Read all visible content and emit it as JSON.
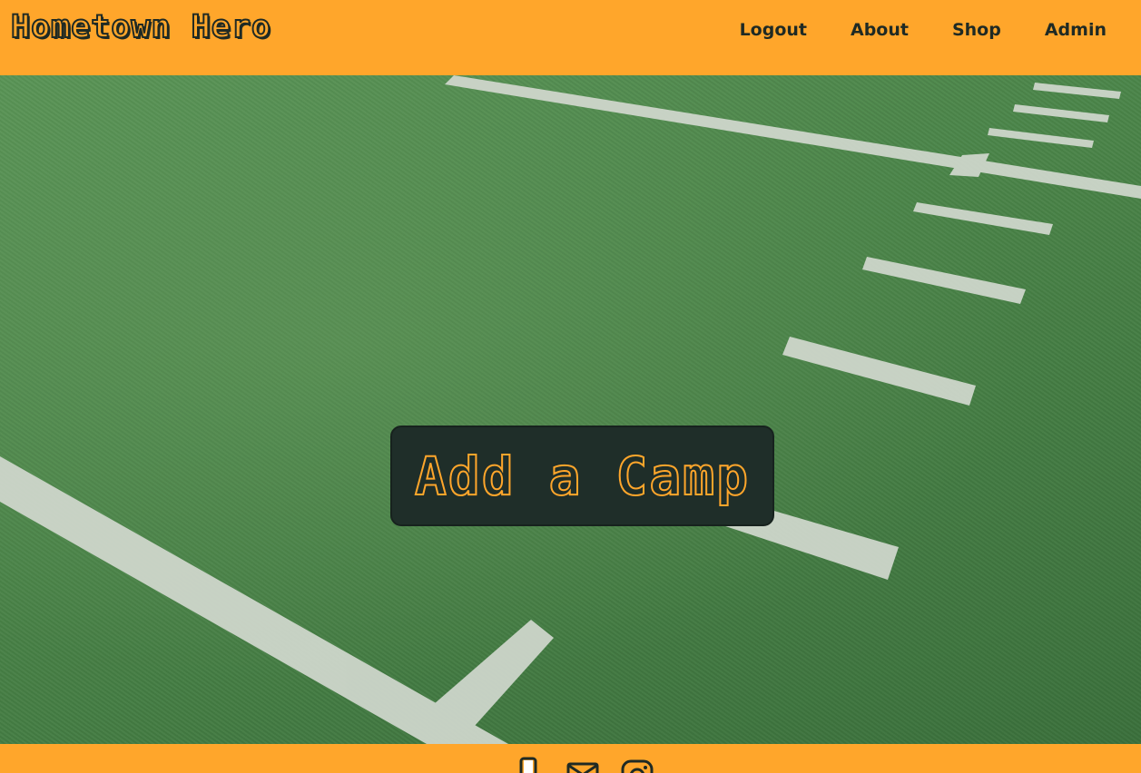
{
  "header": {
    "brand": "Hometown Hero",
    "nav": {
      "logout": "Logout",
      "about": "About",
      "shop": "Shop",
      "admin": "Admin"
    }
  },
  "hero": {
    "background": "football-field-turf",
    "cta_label": "Add a Camp"
  },
  "footer": {
    "icons": [
      "phone-icon",
      "mail-icon",
      "instagram-icon"
    ]
  },
  "colors": {
    "accent": "#ffa62b",
    "dark": "#1f2e29"
  }
}
